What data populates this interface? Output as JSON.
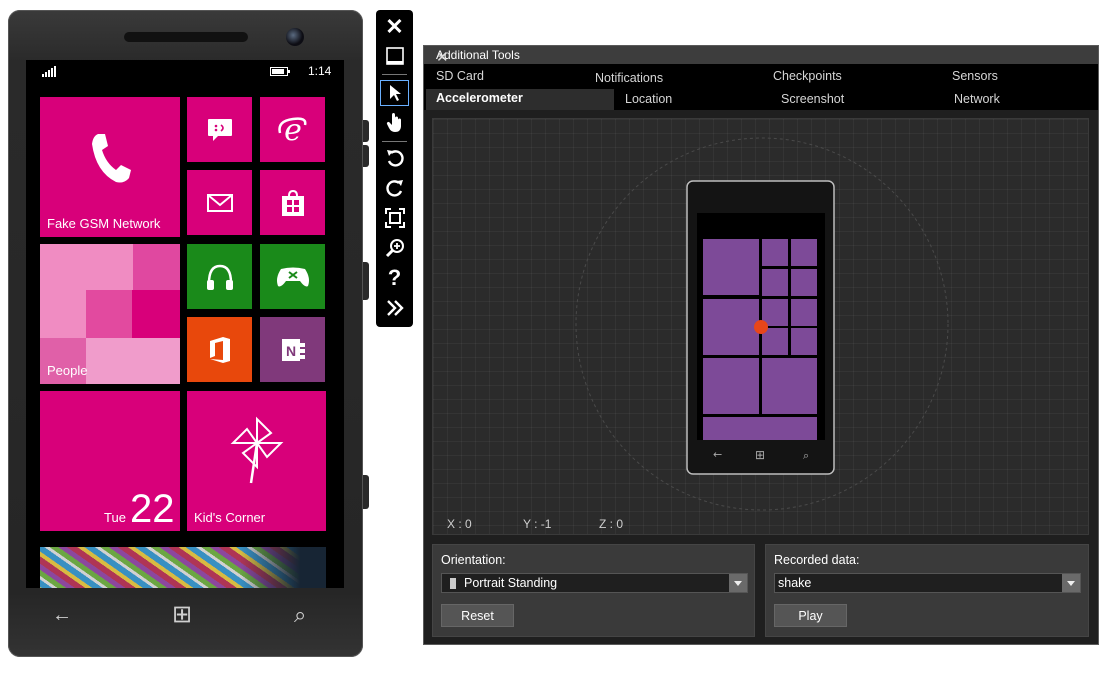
{
  "phone": {
    "status": {
      "time": "1:14"
    },
    "tiles": {
      "phone_label": "Fake GSM Network",
      "people_label": "People",
      "calendar_day": "Tue",
      "calendar_date": "22",
      "kids_corner_label": "Kid's Corner"
    },
    "nav": {
      "back": "←",
      "start": "⊞",
      "search": "⌕"
    }
  },
  "toolbar": {
    "close": "✕",
    "items": [
      "minimize-icon",
      "pointer-icon",
      "hand-icon",
      "rotate-left-icon",
      "rotate-right-icon",
      "fit-screen-icon",
      "zoom-icon",
      "help-icon",
      "additional-tools-icon"
    ]
  },
  "tools": {
    "title": "Additional Tools",
    "close": "✕",
    "tabs_row1": [
      "SD Card",
      "Notifications",
      "Checkpoints",
      "Sensors"
    ],
    "tabs_row2": [
      "Accelerometer",
      "Location",
      "Screenshot",
      "Network"
    ],
    "active_tab": "Accelerometer",
    "axes": {
      "x": "X : 0",
      "y": "Y : -1",
      "z": "Z : 0"
    },
    "orientation": {
      "label": "Orientation:",
      "value": "Portrait Standing",
      "reset": "Reset"
    },
    "recorded": {
      "label": "Recorded data:",
      "value": "shake",
      "play": "Play"
    }
  },
  "colors": {
    "tile_pink": "#d8007a",
    "tile_green": "#1a8a1a",
    "tile_orange": "#e8480c",
    "tile_purple": "#80397b",
    "mini_tile": "#7d4a98",
    "dot": "#e8461a"
  }
}
